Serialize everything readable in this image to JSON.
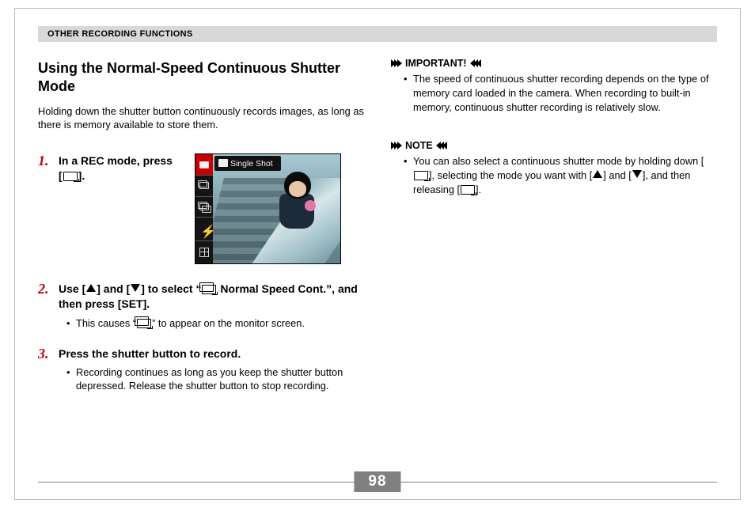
{
  "section_header": "OTHER RECORDING FUNCTIONS",
  "page_number": "98",
  "title": "Using the Normal-Speed Continuous Shutter Mode",
  "intro": "Holding down the shutter button continuously records images, as long as there is memory available to store them.",
  "lcd": {
    "top_label": "Single Shot"
  },
  "steps": {
    "s1": {
      "num": "1.",
      "pre": "In a REC mode, press [",
      "post": "]."
    },
    "s2": {
      "num": "2.",
      "pre": "Use [",
      "mid1": "] and [",
      "mid2": "] to select “",
      "post": " Normal Speed Cont.”, and then press [SET].",
      "bullet_pre": "This causes “",
      "bullet_post": "” to appear on the monitor screen."
    },
    "s3": {
      "num": "3.",
      "main": "Press the shutter button to record.",
      "bullet": "Recording continues as long as you keep the shutter button depressed. Release the shutter button to stop recording."
    }
  },
  "callouts": {
    "important": {
      "label": "IMPORTANT!",
      "bullet": "The speed of continuous shutter recording depends on the type of memory card loaded in the camera. When recording to built-in memory, continuous shutter recording is relatively slow."
    },
    "note": {
      "label": "NOTE",
      "bullet_pre": "You can also select a continuous shutter mode by holding down [",
      "bullet_mid1": "], selecting the mode you want with [",
      "bullet_mid2": "] and [",
      "bullet_mid3": "], and then releasing [",
      "bullet_post": "]."
    }
  }
}
